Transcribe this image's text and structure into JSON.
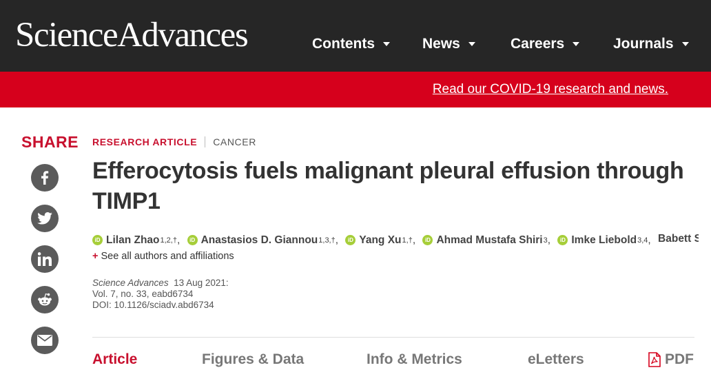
{
  "site": {
    "logo_text": "ScienceAdvances",
    "nav": [
      {
        "label": "Contents"
      },
      {
        "label": "News"
      },
      {
        "label": "Careers"
      },
      {
        "label": "Journals"
      }
    ]
  },
  "banner": {
    "link_text": "Read our COVID-19 research and news."
  },
  "share": {
    "label": "SHARE",
    "buttons": [
      "facebook-icon",
      "twitter-icon",
      "linkedin-icon",
      "reddit-icon",
      "email-icon"
    ]
  },
  "article": {
    "type": "RESEARCH ARTICLE",
    "category": "CANCER",
    "title": "Efferocytosis fuels malignant pleural effusion through TIMP1",
    "authors": [
      {
        "name": "Lilan Zhao",
        "affil": "1,2,†",
        "orcid": true
      },
      {
        "name": "Anastasios D. Giannou",
        "affil": "1,3,†",
        "orcid": true
      },
      {
        "name": "Yang Xu",
        "affil": "1,†",
        "orcid": true
      },
      {
        "name": "Ahmad Mustafa Shiri",
        "affil": "3",
        "orcid": true
      },
      {
        "name": "Imke Liebold",
        "affil": "3,4",
        "orcid": true
      },
      {
        "name": "Babett Stegl...",
        "affil": "",
        "orcid": false
      }
    ],
    "see_all": "See all authors and affiliations",
    "citation": {
      "journal": "Science Advances",
      "date": "13 Aug 2021:",
      "volume": "Vol. 7, no. 33, eabd6734",
      "doi": "DOI: 10.1126/sciadv.abd6734"
    }
  },
  "tabs": {
    "article": "Article",
    "figures": "Figures & Data",
    "info": "Info & Metrics",
    "eletters": "eLetters",
    "pdf": "PDF"
  },
  "colors": {
    "topbar": "#262626",
    "banner": "#d6001c",
    "accent": "#c8102e",
    "orcid": "#a6ce39",
    "share_button": "#5b5b5b"
  }
}
